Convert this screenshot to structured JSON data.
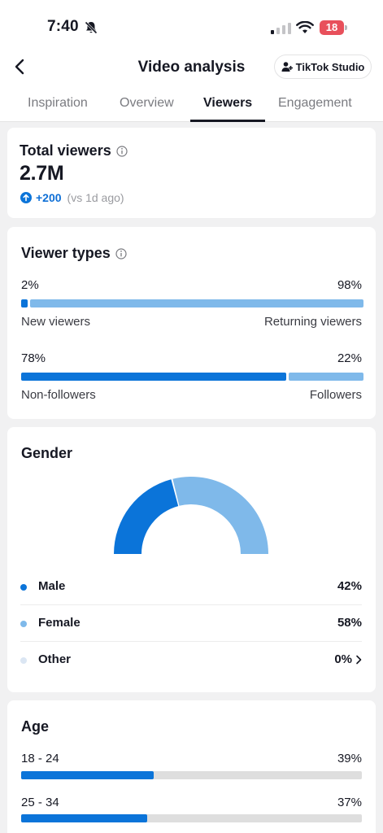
{
  "status_bar": {
    "time": "7:40",
    "battery_level": "18"
  },
  "header": {
    "title": "Video analysis",
    "studio_button": "TikTok Studio"
  },
  "tabs": [
    {
      "label": "Inspiration",
      "active": false
    },
    {
      "label": "Overview",
      "active": false
    },
    {
      "label": "Viewers",
      "active": true
    },
    {
      "label": "Engagement",
      "active": false
    }
  ],
  "total_viewers": {
    "title": "Total viewers",
    "value": "2.7M",
    "delta": "+200",
    "delta_note": "(vs 1d ago)"
  },
  "viewer_types": {
    "title": "Viewer types",
    "rows": [
      {
        "left_pct": "2%",
        "right_pct": "98%",
        "left_label": "New viewers",
        "right_label": "Returning viewers",
        "left_fraction": 0.02
      },
      {
        "left_pct": "78%",
        "right_pct": "22%",
        "left_label": "Non-followers",
        "right_label": "Followers",
        "left_fraction": 0.78
      }
    ]
  },
  "gender": {
    "title": "Gender",
    "items": [
      {
        "label": "Male",
        "value": "42%",
        "share": 42,
        "color": "#0b74d9"
      },
      {
        "label": "Female",
        "value": "58%",
        "share": 58,
        "color": "#7fb9ea"
      },
      {
        "label": "Other",
        "value": "0%",
        "share": 0,
        "color": "#dbe6f3"
      }
    ]
  },
  "age": {
    "title": "Age",
    "rows": [
      {
        "label": "18 - 24",
        "value": "39%",
        "fraction": 0.39
      },
      {
        "label": "25 - 34",
        "value": "37%",
        "fraction": 0.37
      }
    ]
  },
  "colors": {
    "accent": "#0b74d9",
    "accent_light": "#7fb9ea",
    "track": "#dedede",
    "background": "#f1f1f2"
  }
}
